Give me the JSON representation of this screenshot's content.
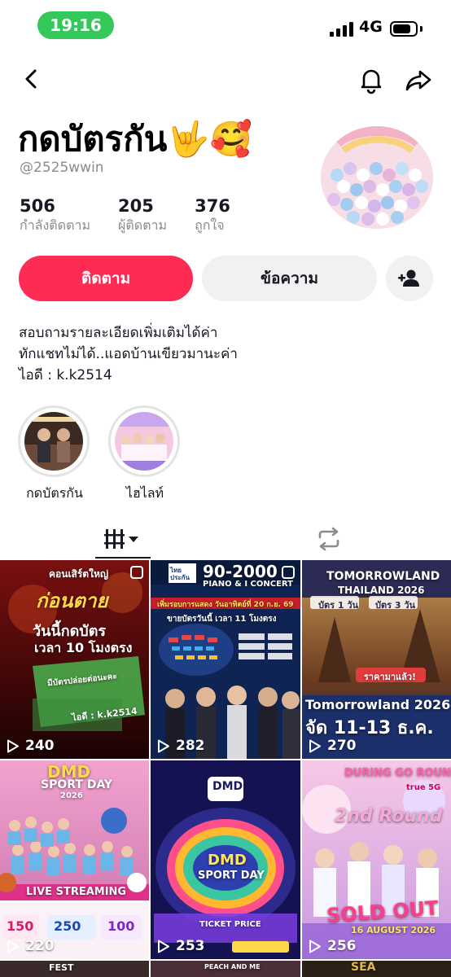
{
  "status_bar": {
    "time": "19:16",
    "network": "4G",
    "battery_level": 0.8
  },
  "profile": {
    "display_name": "กดบัตรกัน🤟🥰",
    "username": "@2525wwin",
    "stats": [
      {
        "value": "506",
        "label": "กำลังติดตาม"
      },
      {
        "value": "205",
        "label": "ผู้ติดตาม"
      },
      {
        "value": "376",
        "label": "ถูกใจ"
      }
    ],
    "follow_label": "ติดตาม",
    "message_label": "ข้อความ",
    "bio_lines": [
      "สอบถามรายละเอียดเพิ่มเติมได้ค่า",
      "ทักแชทไม่ได้..แอดบ้านเขียวมานะค่า",
      "ไอดี : k.k2514"
    ]
  },
  "highlights": [
    {
      "label": "กดบัตรกัน"
    },
    {
      "label": "ไฮไลท์"
    }
  ],
  "tabs": [
    {
      "icon": "grid-icon",
      "active": true
    },
    {
      "icon": "repost-icon",
      "active": false
    }
  ],
  "posts": [
    {
      "views": "240",
      "pinned": true,
      "texts": [
        "คอนเสิร์ตใหญ่",
        "ก่อนตาย",
        "วันนี้กดบัตร",
        "เวลา 10 โมงตรง",
        "มีบัตรปล่อยต่อนะคะ",
        "ไอดี : k.k2514"
      ]
    },
    {
      "views": "282",
      "pinned": true,
      "texts": [
        "ไทย",
        "ประกัน",
        "90-2000",
        "PIANO & I CONCERT",
        "เพิ่มรอบการแสดง วันอาทิตย์ที่ 20 ก.ย. 69",
        "ขายบัตรวันนี้ เวลา 11 โมงตรง"
      ]
    },
    {
      "views": "270",
      "pinned": false,
      "texts": [
        "TOMORROWLAND",
        "THAILAND 2026",
        "บัตร 1 วัน",
        "บัตร 3 วัน",
        "ราคามาแล้ว!",
        "Tomorrowland 2026",
        "จัด 11-13 ธ.ค."
      ]
    },
    {
      "views": "220",
      "pinned": false,
      "texts": [
        "DMD",
        "SPORT DAY",
        "2026",
        "LIVE STREAMING",
        "150",
        "250",
        "100"
      ]
    },
    {
      "views": "253",
      "pinned": false,
      "texts": [
        "DMD",
        "DMD",
        "SPORT DAY",
        "TICKET PRICE"
      ]
    },
    {
      "views": "256",
      "pinned": false,
      "texts": [
        "DURING GO ROUND",
        "true 5G",
        "2nd Round",
        "SOLD OUT",
        "16 AUGUST 2026"
      ]
    }
  ],
  "bottom_strip": [
    "FEST",
    "PEACH AND ME",
    "SEA"
  ],
  "colors": {
    "accent": "#fe2c55",
    "status_green": "#34c759",
    "muted": "#8a8b91"
  }
}
